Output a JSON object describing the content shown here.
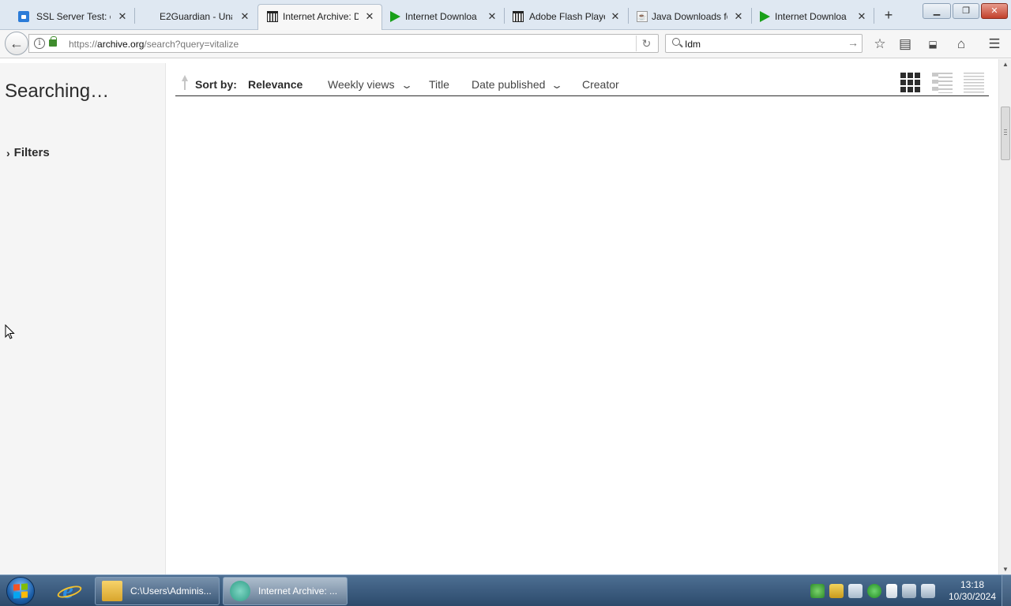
{
  "browser": {
    "tabs": [
      {
        "title": "SSL Server Test: cl",
        "icon": "lock-icon"
      },
      {
        "title": "E2Guardian - Una",
        "icon": "none"
      },
      {
        "title": "Internet Archive: D",
        "icon": "archive-icon",
        "active": true
      },
      {
        "title": "Internet Downloa",
        "icon": "play-icon"
      },
      {
        "title": "Adobe Flash Playe",
        "icon": "archive-icon"
      },
      {
        "title": "Java Downloads fo",
        "icon": "java-icon"
      },
      {
        "title": "Internet Downloa",
        "icon": "play-icon"
      }
    ],
    "url": {
      "scheme": "https://",
      "host": "archive.org",
      "path": "/search?query=vitalize"
    },
    "search_value": "Idm"
  },
  "page": {
    "heading": "Searching…",
    "filters_label": "Filters",
    "sort": {
      "label": "Sort by:",
      "options": [
        {
          "label": "Relevance",
          "selected": true
        },
        {
          "label": "Weekly views",
          "has_dropdown": true
        },
        {
          "label": "Title"
        },
        {
          "label": "Date published",
          "has_dropdown": true
        },
        {
          "label": "Creator"
        }
      ]
    },
    "view_modes": [
      "tiles",
      "list-detail",
      "list-compact"
    ]
  },
  "taskbar": {
    "items": [
      {
        "label": "C:\\Users\\Adminis...",
        "icon": "folder-icon"
      },
      {
        "label": "Internet Archive: ...",
        "icon": "firefox-icon",
        "active": true
      }
    ],
    "clock": {
      "time": "13:18",
      "date": "10/30/2024"
    }
  },
  "colors": {
    "tab_strip": "#dfe8f2",
    "sidebar": "#f5f5f5",
    "text": "#2c2c2c",
    "taskbar": "#2c4a6b"
  }
}
